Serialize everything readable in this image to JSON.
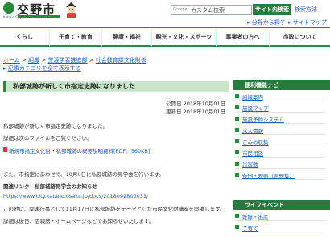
{
  "header": {
    "logo_title": "交野市",
    "logo_sub": "Katano City",
    "search_placeholder": "カスタム検索",
    "search_engine": "Google",
    "site_search_button": "サイト内検索",
    "search_help_link": "検索方法",
    "links": [
      "分野から探す",
      "サイトマップ"
    ]
  },
  "nav": [
    "くらし",
    "子育て・教育",
    "健康・福祉",
    "観光・文化・スポーツ",
    "事業者の方へ",
    "市政について"
  ],
  "breadcrumb": {
    "line1": [
      "ホーム",
      "組織",
      "生涯学習推進部",
      "社会教育課文化財係"
    ],
    "line2": "記事カテゴリを全て表示する"
  },
  "article": {
    "title": "私部城跡が新しく市指定史跡になりました",
    "published": "公開日 2018年10月01日",
    "updated": "更新日 2018年10月01日",
    "p1": "私部城跡が新しく市指定史跡になりました。",
    "p2": "詳細は次のファイルをご覧ください。",
    "pdf_link": "新規市指定文化財・私部城跡の概要説明資料[PDF：560KB]",
    "p3": "また、市指定にあわせて、10月6日に私部城跡の見学会を行います。",
    "related_label": "関連リンク　私部城跡見学会のお知らせ",
    "url": "https://www.city.katano.osaka.jp/docs/2018092800031/",
    "p4": "この他に、関連行事として11月17日に私部城跡をテーマとした市民文化財講座を開催します。",
    "p5": "詳細は後日、広報誌・ホームページなどでお知らせいたします。"
  },
  "sidebar": {
    "nav_title": "便利機能ナビ",
    "nav_items": [
      "組織案内",
      "施設マップ",
      "施設予約システム",
      "求人情報",
      "ごみの収集",
      "市民相談",
      "災害動",
      "条例・規則（例規集）"
    ],
    "life_title": "ライフイベント",
    "life_items": [
      "妊娠・出産",
      "子育て"
    ]
  },
  "colors": {
    "brand_green": "#2a8a3a",
    "link_blue": "#1a5fb4",
    "title_bg": "#c9e6c9"
  }
}
